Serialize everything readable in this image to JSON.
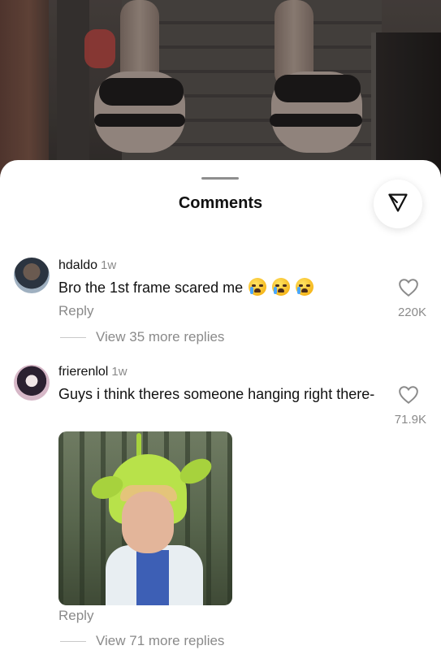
{
  "sheet": {
    "title": "Comments"
  },
  "comments": [
    {
      "username": "hdaldo",
      "time": "1w",
      "text": "Bro the 1st frame scared me",
      "emoji_count": 3,
      "emoji_name": "loudly-crying-face",
      "likes": "220K",
      "reply_label": "Reply",
      "view_replies": "View 35 more replies"
    },
    {
      "username": "frierenlol",
      "time": "1w",
      "text": "Guys i think theres someone hanging right there-",
      "likes": "71.9K",
      "reply_label": "Reply",
      "view_replies": "View 71 more replies",
      "attachment": "photo-green-alien-hat"
    }
  ],
  "icons": {
    "share": "send-icon",
    "like": "heart-icon"
  },
  "colors": {
    "sheet_bg": "#ffffff",
    "muted_text": "#8a8a8a",
    "text": "#111111"
  }
}
